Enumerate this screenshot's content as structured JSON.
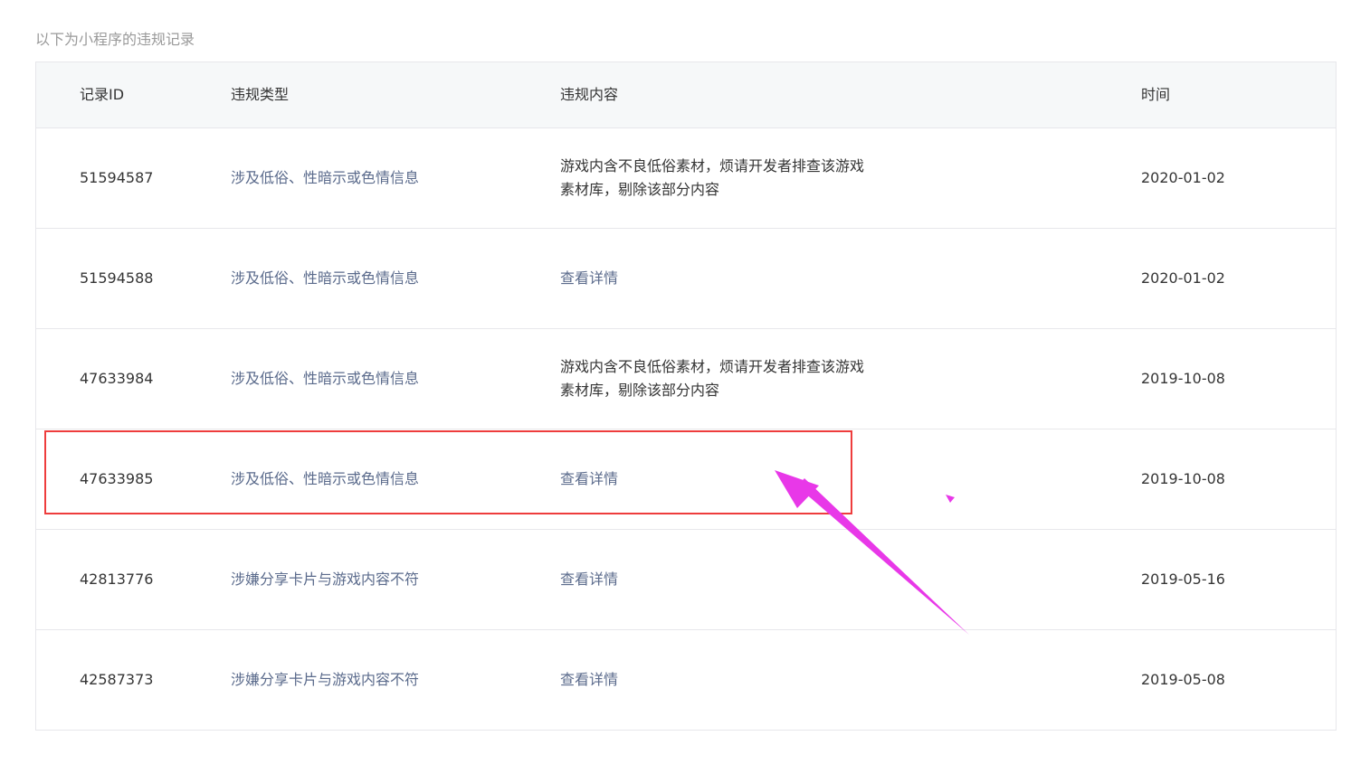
{
  "caption": "以下为小程序的违规记录",
  "columns": {
    "id": "记录ID",
    "type": "违规类型",
    "content": "违规内容",
    "time": "时间"
  },
  "rows": [
    {
      "id": "51594587",
      "type": "涉及低俗、性暗示或色情信息",
      "content_line1": "游戏内含不良低俗素材，烦请开发者排查该游戏",
      "content_line2": "素材库，剔除该部分内容",
      "time": "2020-01-02"
    },
    {
      "id": "51594588",
      "type": "涉及低俗、性暗示或色情信息",
      "content_link": "查看详情",
      "time": "2020-01-02"
    },
    {
      "id": "47633984",
      "type": "涉及低俗、性暗示或色情信息",
      "content_line1": "游戏内含不良低俗素材，烦请开发者排查该游戏",
      "content_line2": "素材库，剔除该部分内容",
      "time": "2019-10-08"
    },
    {
      "id": "47633985",
      "type": "涉及低俗、性暗示或色情信息",
      "content_link": "查看详情",
      "time": "2019-10-08"
    },
    {
      "id": "42813776",
      "type": "涉嫌分享卡片与游戏内容不符",
      "content_link": "查看详情",
      "time": "2019-05-16"
    },
    {
      "id": "42587373",
      "type": "涉嫌分享卡片与游戏内容不符",
      "content_link": "查看详情",
      "time": "2019-05-08"
    }
  ],
  "colors": {
    "link": "#5b6b8c",
    "highlight_box": "#ee3d3d",
    "arrow": "#e838e8",
    "header_bg": "#f6f8f9"
  }
}
